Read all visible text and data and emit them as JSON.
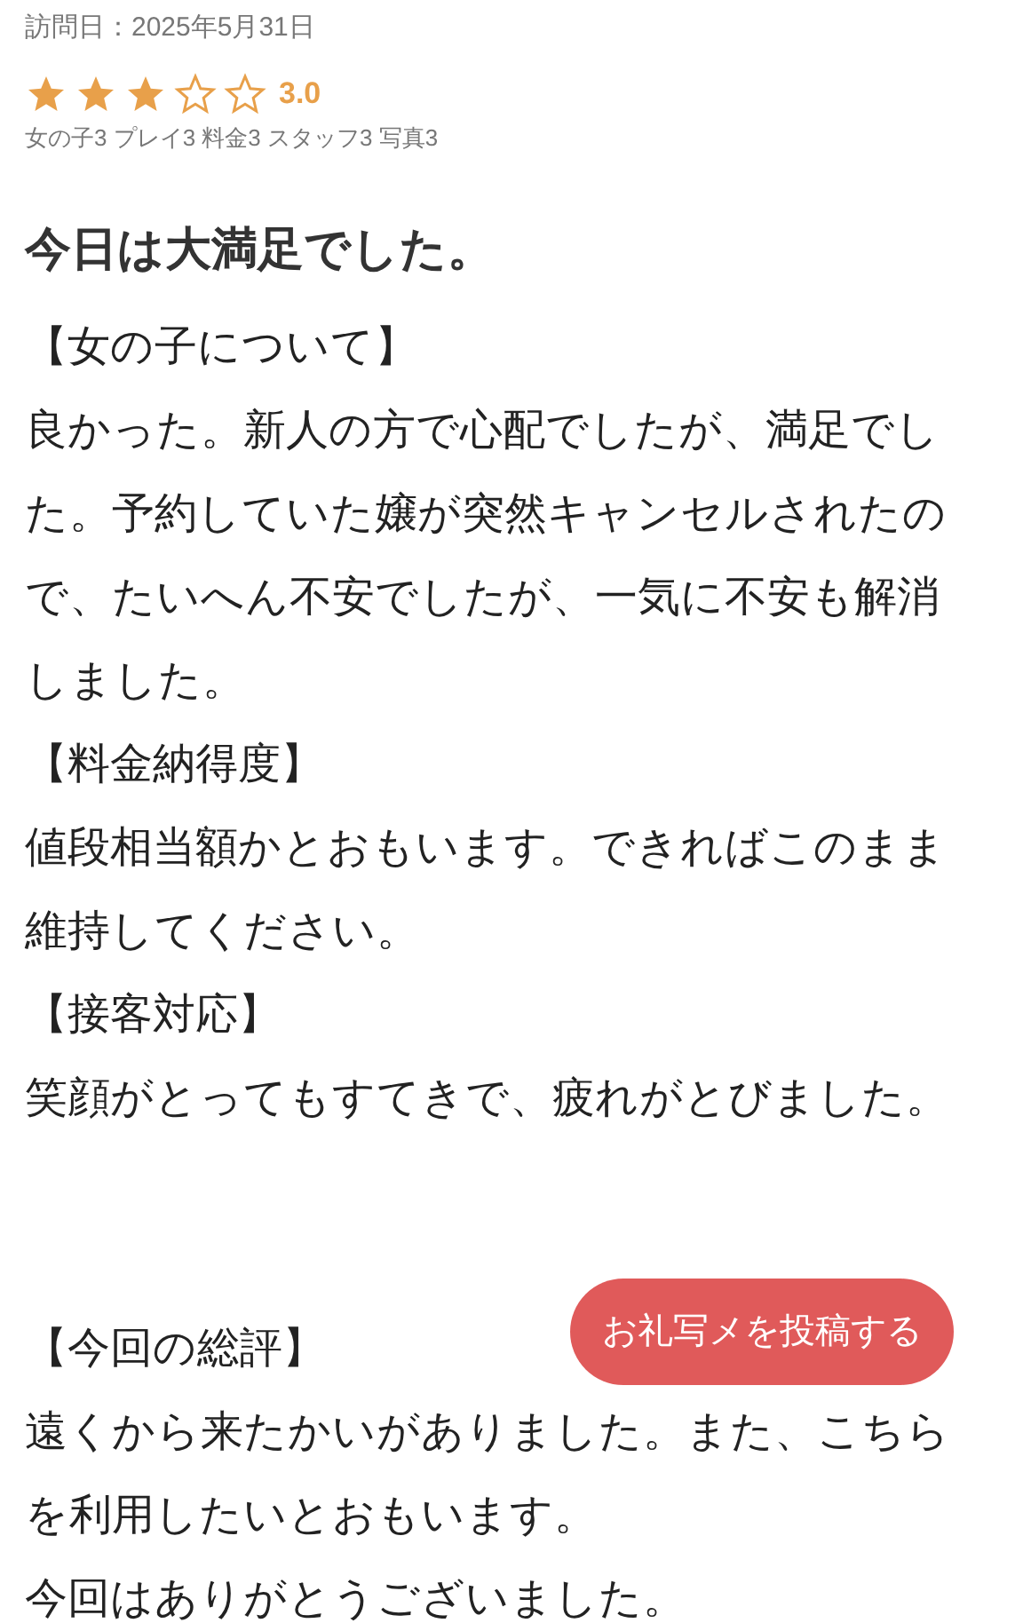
{
  "visit_date": "訪問日：2025年5月31日",
  "rating": {
    "stars": 3,
    "score": "3.0"
  },
  "sub_ratings": "女の子3 プレイ3 料金3 スタッフ3 写真3",
  "title": "今日は大満足でした。",
  "body": [
    {
      "kind": "heading",
      "text": "【女の子について】"
    },
    {
      "kind": "text",
      "text": "良かった。新人の方で心配でしたが、満足でした。予約していた嬢が突然キャンセルされたので、たいへん不安でしたが、一気に不安も解消しました。"
    },
    {
      "kind": "heading",
      "text": "【料金納得度】"
    },
    {
      "kind": "text",
      "text": "値段相当額かとおもいます。できればこのまま維持してください。"
    },
    {
      "kind": "heading",
      "text": "【接客対応】"
    },
    {
      "kind": "text",
      "text": "笑顔がとってもすてきで、疲れがとびました。"
    },
    {
      "kind": "blank"
    },
    {
      "kind": "blank"
    },
    {
      "kind": "heading",
      "text": "【今回の総評】"
    },
    {
      "kind": "text",
      "text": "遠くから来たかいがありました。また、こちらを利用したいとおもいます。"
    },
    {
      "kind": "text",
      "text": "今回はありがとうございました。"
    }
  ],
  "post_button": "お礼写メを投稿する"
}
